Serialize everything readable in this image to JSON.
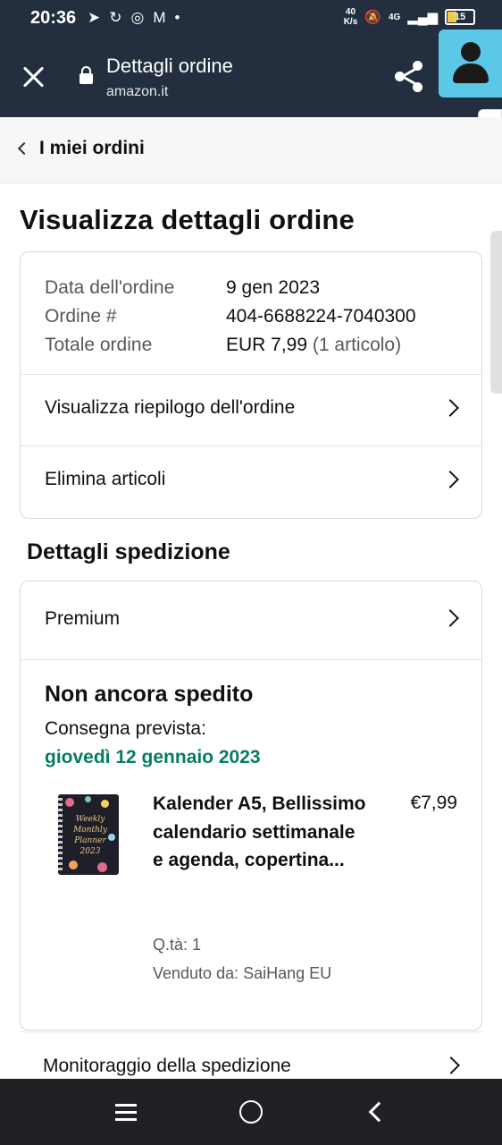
{
  "status_bar": {
    "time": "20:36",
    "speed_value": "40",
    "speed_unit": "K/s",
    "network": "4G",
    "battery": "15",
    "icons": [
      "telegram-icon",
      "sync-icon",
      "chrome-icon",
      "gmail-icon",
      "dot-icon",
      "mute-icon",
      "signal-icon",
      "battery-icon"
    ]
  },
  "header": {
    "title": "Dettagli ordine",
    "url": "amazon.it",
    "colors": {
      "bar": "#232f3e",
      "avatar_bg": "#5cc8e8"
    }
  },
  "breadcrumb": {
    "label": "I miei ordini"
  },
  "page": {
    "title": "Visualizza dettagli ordine"
  },
  "order_summary": {
    "rows": [
      {
        "key": "Data dell'ordine",
        "value": "9 gen 2023"
      },
      {
        "key": "Ordine #",
        "value": "404-6688224-7040300"
      },
      {
        "key": "Totale ordine",
        "value": "EUR 7,99",
        "extra": "(1 articolo)"
      }
    ],
    "links": [
      "Visualizza riepilogo dell'ordine",
      "Elimina articoli"
    ]
  },
  "shipment": {
    "section_title": "Dettagli spedizione",
    "shipping_type": "Premium",
    "status": "Non ancora spedito",
    "eta_label": "Consegna prevista:",
    "eta_date": "giovedì 12 gennaio 2023",
    "eta_color": "#067d62",
    "item": {
      "title": "Kalender A5, Bellissimo calendario settimanale e agenda, copertina...",
      "price": "€7,99",
      "qty": "Q.tà: 1",
      "seller": "Venduto da: SaiHang EU",
      "cover_text": [
        "Weekly",
        "Monthly",
        "Planner",
        "2023"
      ]
    },
    "tracking_link": "Monitoraggio della spedizione"
  }
}
